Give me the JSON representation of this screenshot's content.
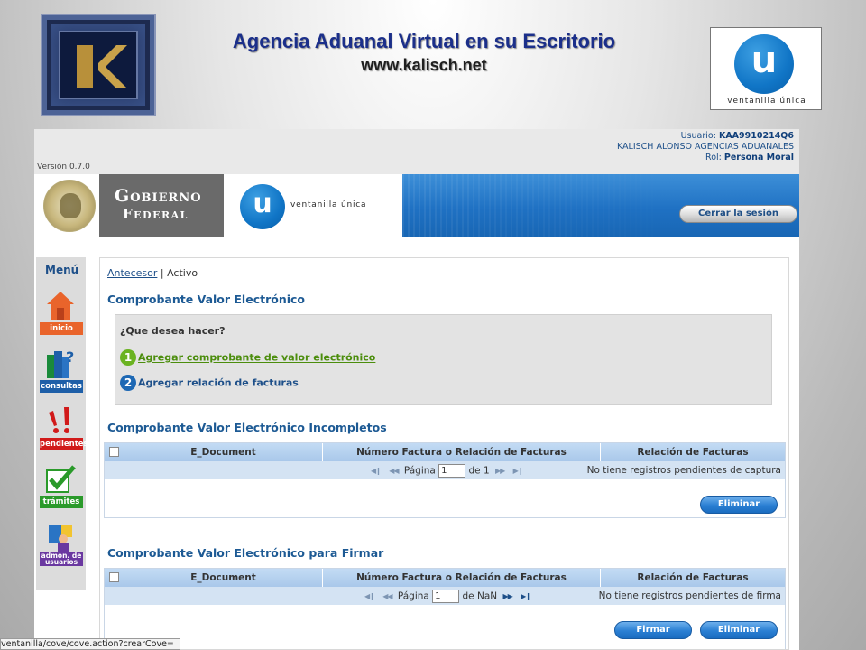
{
  "slide": {
    "title": "Agencia Aduanal Virtual en su Escritorio",
    "url": "www.kalisch.net",
    "logo_right_label": "ventanilla única",
    "logo_right_letter": "u"
  },
  "app": {
    "version": "Versión 0.7.0",
    "user": {
      "usuario_label": "Usuario:",
      "usuario_value": "KAA9910214Q6",
      "company": "KALISCH ALONSO AGENCIAS ADUANALES",
      "rol_label": "Rol:",
      "rol_value": "Persona Moral"
    },
    "banner": {
      "gobierno_l1": "Gobierno",
      "gobierno_l2": "Federal",
      "vu_letter": "u",
      "vu_label": "ventanilla única",
      "logout_label": "Cerrar la sesión"
    },
    "menu": {
      "title": "Menú",
      "items": [
        {
          "label": "inicio",
          "icon": "home-icon",
          "color": "#e9642b"
        },
        {
          "label": "consultas",
          "icon": "books-question-icon",
          "color": "#1e5fa8"
        },
        {
          "label": "pendientes",
          "icon": "exclamation-icon",
          "color": "#d11a1a"
        },
        {
          "label": "trámites",
          "icon": "checkmark-icon",
          "color": "#2a9a2a"
        },
        {
          "label": "admon. de usuarios",
          "icon": "users-admin-icon",
          "color": "#6a38a0"
        }
      ]
    },
    "breadcrumb": {
      "link": "Antecesor",
      "separator": " | ",
      "current": "Activo"
    },
    "main": {
      "section1_title": "Comprobante Valor Electrónico",
      "question": "¿Que desea hacer?",
      "options": [
        {
          "num": "1",
          "label": "Agregar comprobante de valor electrónico",
          "color": "#6bb321"
        },
        {
          "num": "2",
          "label": "Agregar relación de facturas",
          "color": "#1d68b4"
        }
      ],
      "incompletos": {
        "title": "Comprobante Valor Electrónico Incompletos",
        "columns": [
          "E_Document",
          "Número Factura o Relación de Facturas",
          "Relación de Facturas"
        ],
        "pager": {
          "page_label": "Página",
          "page_value": "1",
          "of_label": "de 1"
        },
        "message": "No tiene registros pendientes de captura",
        "buttons": {
          "delete": "Eliminar"
        }
      },
      "firmar": {
        "title": "Comprobante Valor Electrónico para Firmar",
        "columns": [
          "E_Document",
          "Número Factura o Relación de Facturas",
          "Relación de Facturas"
        ],
        "pager": {
          "page_label": "Página",
          "page_value": "1",
          "of_label": "de NaN"
        },
        "message": "No tiene registros pendientes de firma",
        "buttons": {
          "sign": "Firmar",
          "delete": "Eliminar"
        }
      }
    },
    "status_bar": "ventanilla/cove/cove.action?crearCove="
  }
}
